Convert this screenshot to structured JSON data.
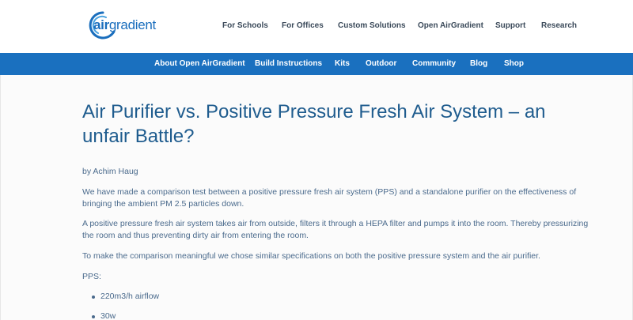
{
  "logo": {
    "air": "air",
    "gradient": "gradient"
  },
  "top_nav": [
    "For Schools",
    "For Offices",
    "Custom Solutions",
    "Open AirGradient",
    "Support",
    "Research"
  ],
  "blue_nav": [
    "About Open AirGradient",
    "Build Instructions",
    "Kits",
    "Outdoor",
    "Community",
    "Blog",
    "Shop"
  ],
  "article": {
    "title": "Air Purifier vs. Positive Pressure Fresh Air System – an unfair Battle?",
    "byline": "by Achim Haug",
    "paragraphs": [
      "We have made a comparison test between a positive pressure fresh air system (PPS) and a standalone purifier on the effectiveness of bringing the ambient PM 2.5 particles down.",
      "A positive pressure fresh air system takes air from outside, filters it through a HEPA filter and pumps it into the room. Thereby pressurizing the room and thus preventing dirty air from entering the room.",
      "To make the comparison meaningful we chose similar specifications on both the positive pressure system and the air purifier.",
      "PPS:"
    ],
    "bullets": [
      "220m3/h airflow",
      "30w"
    ]
  },
  "colors": {
    "accent": "#1a70bf",
    "title": "#1f5c8e",
    "text": "#4a6a8c"
  }
}
